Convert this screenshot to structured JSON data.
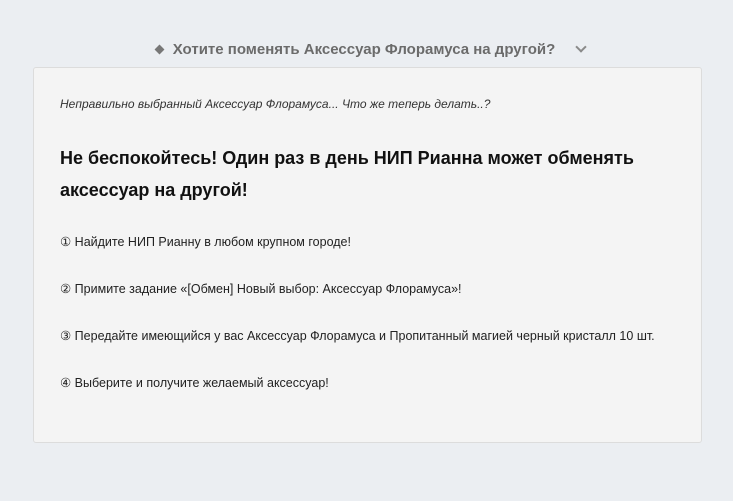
{
  "accordion": {
    "title": "Хотите поменять Аксессуар Флорамуса на другой?",
    "expanded": true,
    "icon": "diamond-bullet-icon",
    "toggle_icon": "chevron-down-icon"
  },
  "panel": {
    "intro": "Неправильно выбранный Аксессуар Флорамуса... Что же теперь делать..?",
    "headline": "Не беспокойтесь! Один раз в день НИП Рианна может обменять аксессуар на другой!",
    "steps": [
      "① Найдите НИП Рианну в любом крупном городе!",
      "② Примите задание «[Обмен] Новый выбор: Аксессуар Флорамуса»!",
      "③ Передайте имеющийся у вас Аксессуар Флорамуса и Пропитанный магией черный кристалл 10 шт.",
      "④ Выберите и получите желаемый аксессуар!"
    ]
  },
  "colors": {
    "page_background": "#ebeef2",
    "panel_background": "#f4f4f4",
    "header_text": "#6b6b6b"
  }
}
